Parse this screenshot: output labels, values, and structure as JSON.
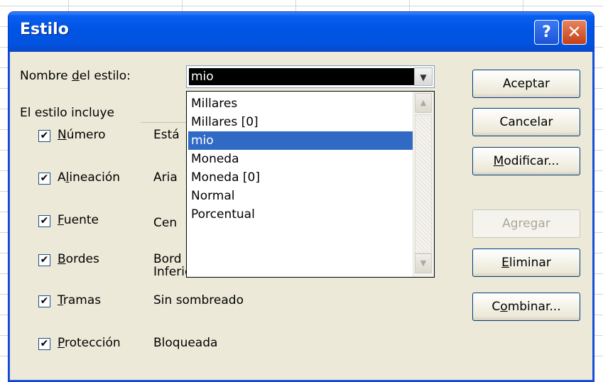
{
  "dialog": {
    "title": "Estilo"
  },
  "titlebar": {
    "help": "?",
    "close": "✕"
  },
  "style_name": {
    "label": "Nombre del estilo:",
    "value": "mio"
  },
  "group": {
    "label": "El estilo incluye"
  },
  "includes": [
    {
      "label": "Número",
      "value": "Está",
      "checked": true
    },
    {
      "label": "Alineación",
      "value": "Aria",
      "checked": true
    },
    {
      "label": "Fuente",
      "value": "Cen",
      "checked": true
    },
    {
      "label": "Bordes",
      "value": "Bord",
      "value2": "Inferior",
      "checked": true
    },
    {
      "label": "Tramas",
      "value": "Sin sombreado",
      "checked": true
    },
    {
      "label": "Protección",
      "value": "Bloqueada",
      "checked": true
    }
  ],
  "dropdown": {
    "items": [
      "Millares",
      "Millares [0]",
      "mio",
      "Moneda",
      "Moneda [0]",
      "Normal",
      "Porcentual"
    ],
    "selected_index": 2
  },
  "buttons": {
    "accept": "Aceptar",
    "cancel": "Cancelar",
    "modify": "Modificar...",
    "add": "Agregar",
    "delete": "Eliminar",
    "merge": "Combinar..."
  },
  "colors": {
    "title_bar": "#0054e3",
    "selection": "#316ac5",
    "dialog_bg": "#ece9d8"
  }
}
